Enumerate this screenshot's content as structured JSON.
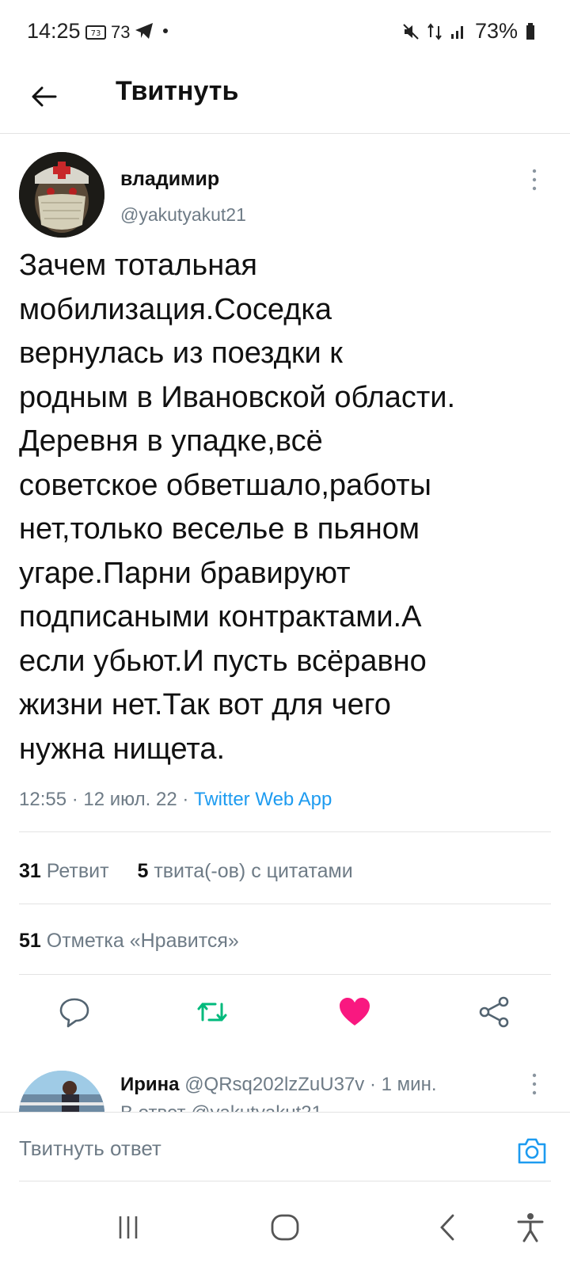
{
  "status_bar": {
    "time": "14:25",
    "notif_badge": "73",
    "notif_count": "73",
    "battery": "73%"
  },
  "header": {
    "title": "Твитнуть",
    "back_icon": "arrow-left-icon"
  },
  "tweet": {
    "author_name": "владимир",
    "author_handle": "@yakutyakut21",
    "text": "Зачем тотальная\nмобилизация.Соседка\nвернулась из поездки к\nродным в Ивановской области.\nДеревня в упадке,всё\nсоветское обветшало,работы\nнет,только веселье в пьяном\nугаре.Парни бравируют\nподписаными контрактами.А\nесли убьют.И пусть всёравно\nжизни нет.Так вот для чего\nнужна нищета.",
    "time": "12:55",
    "date": "12 июл. 22",
    "separator": " · ",
    "source": "Twitter Web App"
  },
  "stats": {
    "retweets_count": "31",
    "retweets_label": "Ретвит",
    "quotes_count": "5",
    "quotes_label": "твита(-ов) с цитатами",
    "likes_count": "51",
    "likes_label": "Отметка «Нравится»"
  },
  "actions": [
    "reply-icon",
    "retweet-icon",
    "like-icon",
    "share-icon"
  ],
  "reply_preview": {
    "name": "Ирина",
    "handle": "@QRsq202lzZuU37v",
    "time": "· 1 мин.",
    "partial_text": "В ответ @yakutyakut21"
  },
  "composer": {
    "placeholder": "Твитнуть ответ"
  },
  "colors": {
    "accent": "#1d9bf0",
    "retweet": "#00ba7c",
    "like": "#f91880",
    "muted": "#6e7b86"
  }
}
